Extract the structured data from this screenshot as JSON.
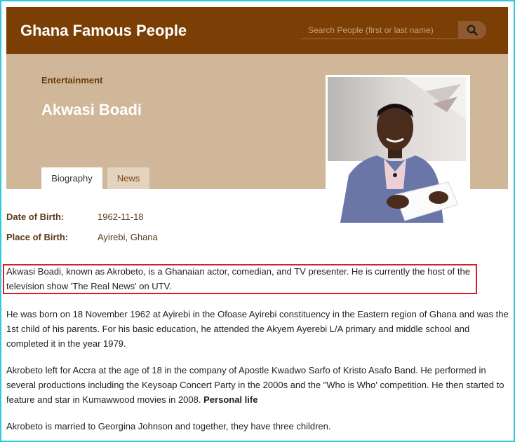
{
  "header": {
    "site_title": "Ghana Famous People",
    "search_placeholder": "Search People (first or last name)"
  },
  "profile": {
    "category": "Entertainment",
    "name": "Akwasi Boadi",
    "tabs": [
      {
        "label": "Biography",
        "active": true
      },
      {
        "label": "News",
        "active": false
      }
    ],
    "facts": [
      {
        "label": "Date of Birth:",
        "value": "1962-11-18"
      },
      {
        "label": "Place of Birth:",
        "value": "Ayirebi, Ghana"
      }
    ]
  },
  "biography": {
    "paragraphs": [
      "Akwasi Boadi, known as Akrobeto, is a Ghanaian actor, comedian, and TV presenter. He is currently the host of the television show 'The Real News' on UTV.",
      "He was born on 18 November 1962 at Ayirebi in the Ofoase Ayirebi constituency in the Eastern region of Ghana and was the 1st child of his parents. For his basic education, he attended the Akyem Ayerebi L/A primary and middle school and completed it in the year 1979.",
      "Akrobeto left for Accra at the age of 18 in the company of Apostle Kwadwo Sarfo of Kristo Asafo Band. He performed in several productions including the Keysoap Concert Party in the 2000s and the \"Who is Who' competition. He then started to feature and star in Kumawwood movies in 2008.",
      "Akrobeto is married to Georgina Johnson and together, they have three children."
    ],
    "inline_heading": "Personal life"
  },
  "colors": {
    "header_bg": "#7b3f05",
    "hero_bg": "#d0b799",
    "highlight_border": "#d8202a",
    "frame_border": "#33c9dd"
  },
  "icons": {
    "search": "search-icon"
  }
}
